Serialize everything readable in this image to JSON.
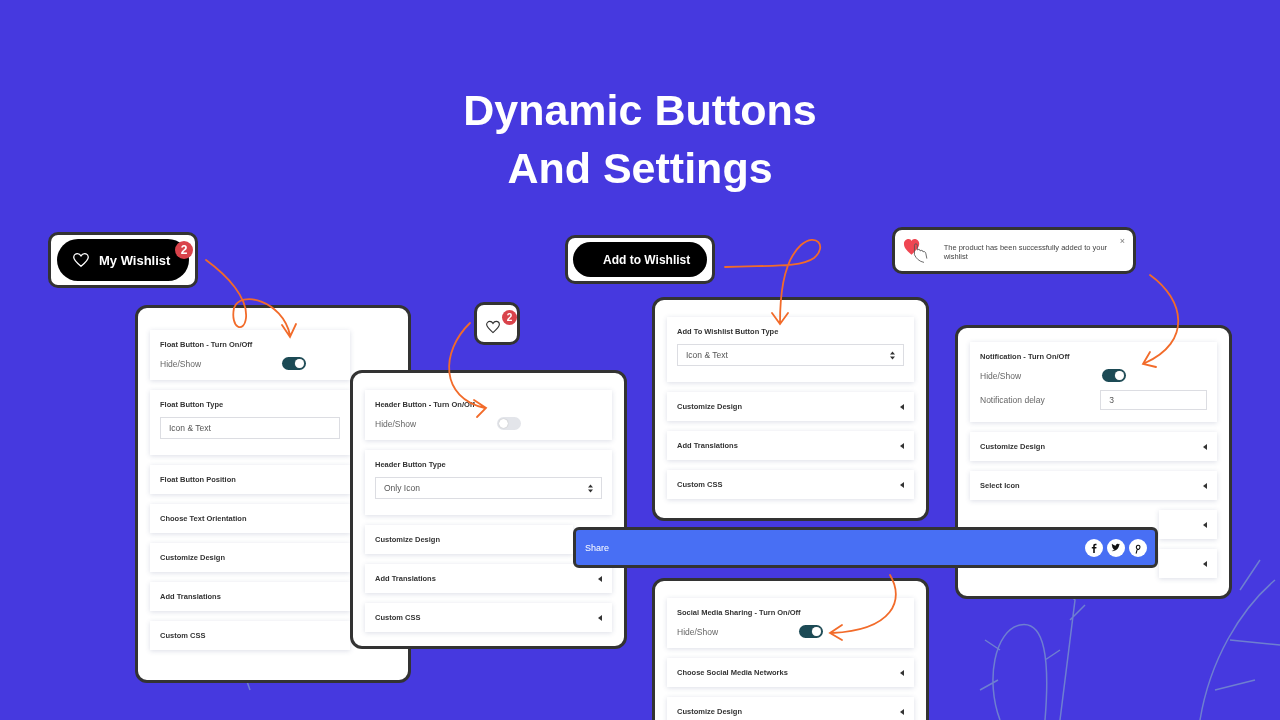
{
  "title": {
    "lines": [
      "Dynamic Buttons",
      "And Settings"
    ]
  },
  "float_button_preview": {
    "label": "My Wishlist",
    "badge": "2"
  },
  "header_icon_preview": {
    "badge": "2"
  },
  "add_to_wishlist_preview": {
    "label": "Add to Wishlist"
  },
  "notification_preview": {
    "message": "The product has been successfully added to your wishlist",
    "close": "×"
  },
  "panels": [
    {
      "sections": [
        {
          "kind": "toggle",
          "title": "Float Button - Turn On/Off",
          "label": "Hide/Show",
          "on": true
        },
        {
          "kind": "field",
          "title": "Float Button Type",
          "value": "Icon & Text"
        },
        {
          "kind": "heading",
          "title": "Float Button Position"
        },
        {
          "kind": "heading",
          "title": "Choose Text Orientation"
        },
        {
          "kind": "heading",
          "title": "Customize Design"
        },
        {
          "kind": "heading",
          "title": "Add Translations"
        },
        {
          "kind": "heading",
          "title": "Custom CSS"
        }
      ]
    },
    {
      "sections": [
        {
          "kind": "toggle",
          "title": "Header Button - Turn On/Off",
          "label": "Hide/Show",
          "on": false
        },
        {
          "kind": "select",
          "title": "Header Button Type",
          "value": "Only Icon"
        },
        {
          "kind": "heading",
          "title": "Customize Design"
        },
        {
          "kind": "collapsible",
          "title": "Add Translations"
        },
        {
          "kind": "collapsible",
          "title": "Custom CSS"
        }
      ]
    },
    {
      "sections": [
        {
          "kind": "select",
          "title": "Add To Wishlist Button Type",
          "value": "Icon & Text"
        },
        {
          "kind": "collapsible",
          "title": "Customize Design"
        },
        {
          "kind": "collapsible",
          "title": "Add Translations"
        },
        {
          "kind": "collapsible",
          "title": "Custom CSS"
        }
      ]
    },
    {
      "sections": [
        {
          "kind": "toggle",
          "title": "Notification - Turn On/Off",
          "label": "Hide/Show",
          "on": true,
          "field": {
            "label": "Notification delay",
            "value": "3"
          }
        },
        {
          "kind": "collapsible",
          "title": "Customize Design"
        },
        {
          "kind": "collapsible",
          "title": "Select Icon"
        },
        {
          "kind": "collapsible"
        },
        {
          "kind": "collapsible"
        }
      ]
    },
    {
      "sections": [
        {
          "kind": "toggle",
          "title": "Social Media Sharing - Turn On/Off",
          "label": "Hide/Show",
          "on": true
        },
        {
          "kind": "collapsible",
          "title": "Choose Social Media Networks"
        },
        {
          "kind": "collapsible",
          "title": "Customize Design"
        }
      ]
    }
  ],
  "share_bar": {
    "label": "Share"
  }
}
